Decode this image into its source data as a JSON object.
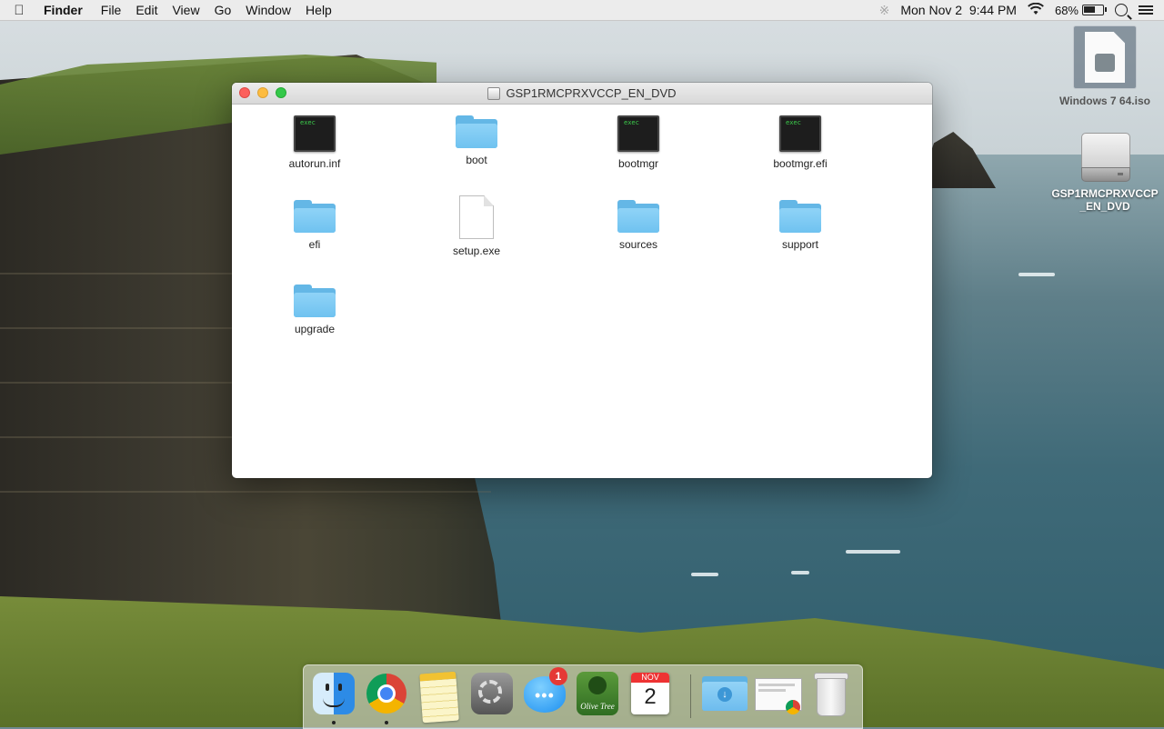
{
  "menubar": {
    "apple": "",
    "app_name": "Finder",
    "menus": [
      "File",
      "Edit",
      "View",
      "Go",
      "Window",
      "Help"
    ],
    "status": {
      "datetime": "Mon Nov 2  9:44 PM",
      "battery_percent": "68%",
      "battery_level": 0.68
    }
  },
  "desktop": {
    "icons": [
      {
        "label": "Windows 7 64.iso",
        "icon": "disk-image-icon"
      },
      {
        "label": "GSP1RMCPRXVCCP_EN_DVD",
        "icon": "external-drive-icon"
      }
    ]
  },
  "window": {
    "title": "GSP1RMCPRXVCCP_EN_DVD",
    "items": [
      {
        "name": "autorun.inf",
        "icon": "exec-icon"
      },
      {
        "name": "boot",
        "icon": "folder-icon"
      },
      {
        "name": "bootmgr",
        "icon": "exec-icon"
      },
      {
        "name": "bootmgr.efi",
        "icon": "exec-icon"
      },
      {
        "name": "efi",
        "icon": "folder-icon"
      },
      {
        "name": "setup.exe",
        "icon": "document-icon"
      },
      {
        "name": "sources",
        "icon": "folder-icon"
      },
      {
        "name": "support",
        "icon": "folder-icon"
      },
      {
        "name": "upgrade",
        "icon": "folder-icon"
      }
    ],
    "exec_badge": "exec"
  },
  "dock": {
    "messages_badge": "1",
    "calendar_month": "NOV",
    "calendar_day": "2",
    "olive_tree_label": "Olive Tree"
  }
}
